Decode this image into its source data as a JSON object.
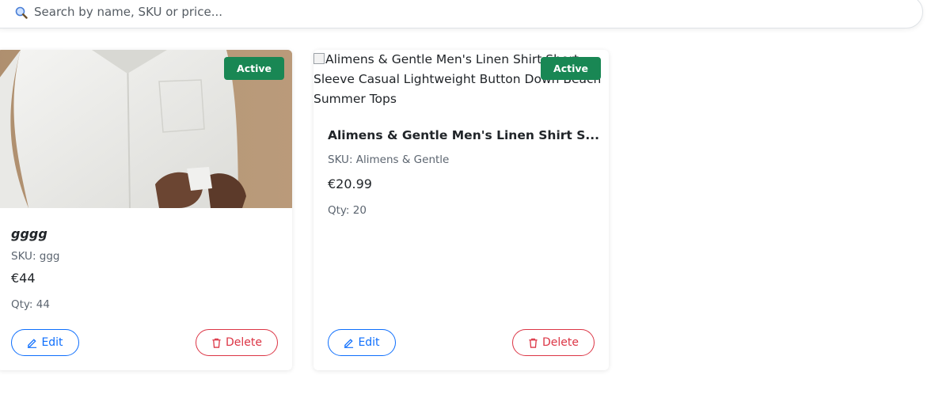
{
  "search": {
    "placeholder": "Search by name, SKU or price..."
  },
  "colors": {
    "badge_active": "#198754",
    "edit": "#0d6efd",
    "delete": "#dc3545"
  },
  "products": [
    {
      "name": "gggg",
      "sku": "SKU: ggg",
      "price": "€44",
      "qty": "Qty: 44",
      "status": "Active",
      "image": "photo of man in white shirt",
      "edit_label": "Edit",
      "delete_label": "Delete"
    },
    {
      "name": "Alimens & Gentle Men's Linen Shirt S...",
      "image_alt": "Alimens & Gentle Men's Linen Shirt Short Sleeve Casual Lightweight Button Down Beach Summer Tops",
      "sku": "SKU: Alimens & Gentle",
      "price": "€20.99",
      "qty": "Qty: 20",
      "status": "Active",
      "edit_label": "Edit",
      "delete_label": "Delete"
    }
  ]
}
